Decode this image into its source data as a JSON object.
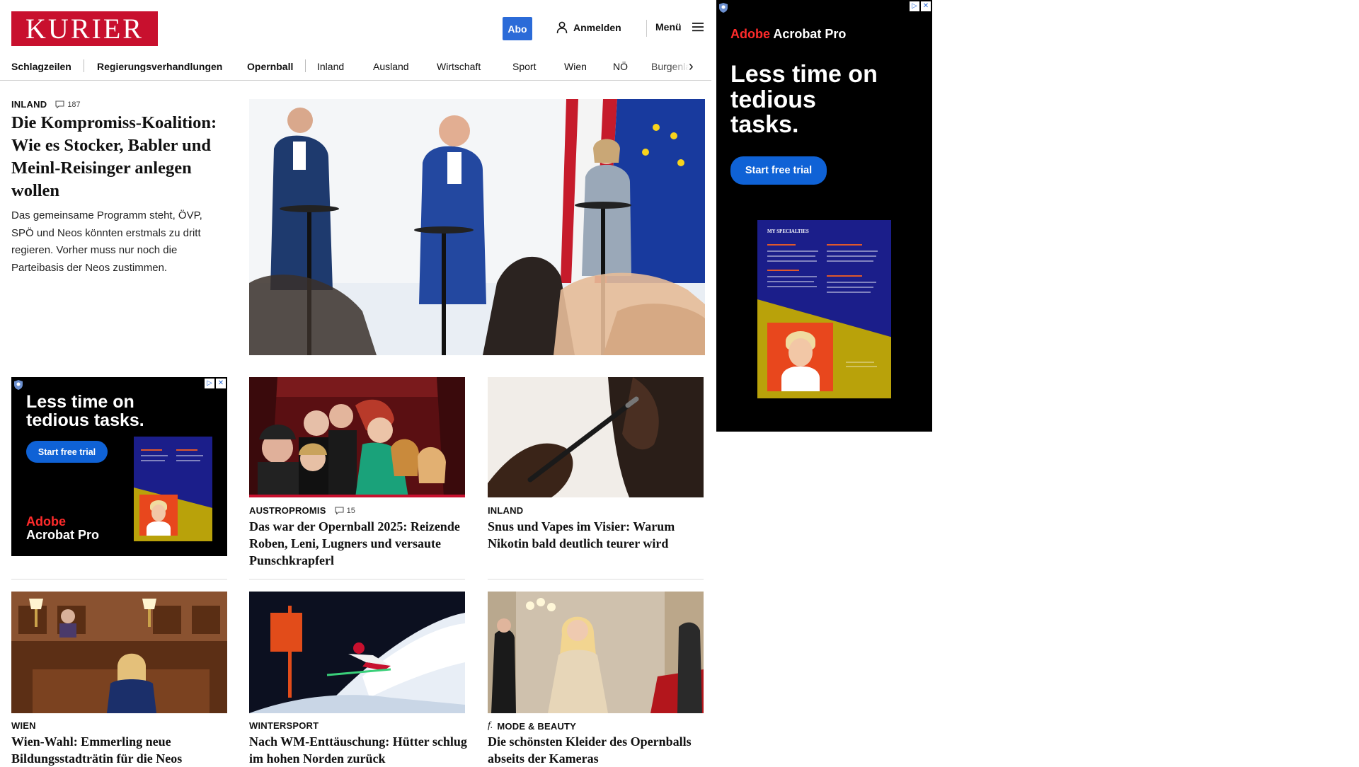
{
  "header": {
    "logo": "KURIER",
    "abo": "Abo",
    "login": "Anmelden",
    "menu": "Menü"
  },
  "nav": {
    "items": [
      "Schlagzeilen",
      "Regierungsverhandlungen",
      "Opernball",
      "Inland",
      "Ausland",
      "Wirtschaft",
      "Sport",
      "Wien",
      "NÖ",
      "Burgenland"
    ]
  },
  "lead": {
    "kicker": "INLAND",
    "comments": "187",
    "title": "Die Kompromiss-Koalition: Wie es Stocker, Babler und Meinl-Reisinger anlegen wollen",
    "teaser": "Das gemeinsame Programm steht, ÖVP, SPÖ und Neos könnten erstmals zu dritt regieren. Vorher muss nur noch die Parteibasis der Neos zustimmen."
  },
  "cards": [
    {
      "kicker": "AUSTROPROMIS",
      "comments": "15",
      "title": "Das war der Opernball 2025: Reizende Roben, Leni, Lugners und versaute Punschkrapferl"
    },
    {
      "kicker": "INLAND",
      "title": "Snus und Vapes im Visier: Warum Nikotin bald deutlich teurer wird"
    },
    {
      "kicker": "WIEN",
      "title": "Wien-Wahl: Emmerling neue Bildungsstadträtin für die Neos"
    },
    {
      "kicker": "WINTERSPORT",
      "title": "Nach WM-Enttäuschung: Hütter schlug im hohen Norden zurück"
    },
    {
      "kicker": "MODE & BEAUTY",
      "icon": "f.",
      "title": "Die schönsten Kleider des Opernballs abseits der Kameras"
    }
  ],
  "ads": {
    "inline": {
      "headline": "Less time on tedious tasks.",
      "cta": "Start free trial",
      "brand_word": "Adobe",
      "brand_product": "Acrobat Pro"
    },
    "sidebar": {
      "brand_word": "Adobe",
      "brand_product": "Acrobat Pro",
      "headline": "Less time on tedious tasks.",
      "cta": "Start free trial",
      "visual_title": "MY SPECIALTIES"
    }
  },
  "colors": {
    "logo": "#c8102e",
    "abo": "#2b6bd8",
    "ad_button": "#0f62d6",
    "ad_visual_bg": "#1b1e8a",
    "ad_visual_yellow": "#b9a20a"
  }
}
